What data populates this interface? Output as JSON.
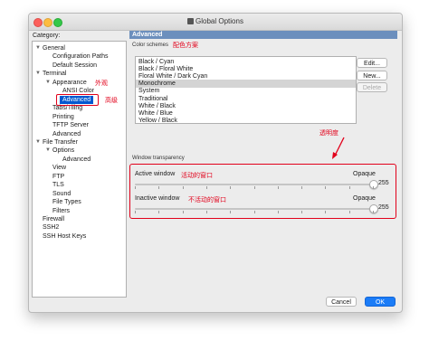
{
  "window": {
    "title": "Global Options"
  },
  "category": {
    "label": "Category:",
    "tree": [
      {
        "label": "General",
        "level": 0,
        "expanded": true
      },
      {
        "label": "Configuration Paths",
        "level": 1
      },
      {
        "label": "Default Session",
        "level": 1
      },
      {
        "label": "Terminal",
        "level": 0,
        "expanded": true
      },
      {
        "label": "Appearance",
        "level": 1,
        "expanded": true
      },
      {
        "label": "ANSI Color",
        "level": 2
      },
      {
        "label": "Advanced",
        "level": 2,
        "selected": true
      },
      {
        "label": "Tabs/Tiling",
        "level": 1
      },
      {
        "label": "Printing",
        "level": 1
      },
      {
        "label": "TFTP Server",
        "level": 1
      },
      {
        "label": "Advanced",
        "level": 1
      },
      {
        "label": "File Transfer",
        "level": 0,
        "expanded": true
      },
      {
        "label": "Options",
        "level": 1,
        "expanded": true
      },
      {
        "label": "Advanced",
        "level": 2
      },
      {
        "label": "View",
        "level": 1
      },
      {
        "label": "FTP",
        "level": 1
      },
      {
        "label": "TLS",
        "level": 1
      },
      {
        "label": "Sound",
        "level": 1
      },
      {
        "label": "File Types",
        "level": 1
      },
      {
        "label": "Filters",
        "level": 1
      },
      {
        "label": "Firewall",
        "level": 0
      },
      {
        "label": "SSH2",
        "level": 0
      },
      {
        "label": "SSH Host Keys",
        "level": 0
      }
    ]
  },
  "panel": {
    "title": "Advanced"
  },
  "color_schemes": {
    "title": "Color schemes",
    "items": [
      "Black / Cyan",
      "Black / Floral White",
      "Floral White / Dark Cyan",
      "Monochrome",
      "System",
      "Traditional",
      "White / Black",
      "White / Blue",
      "Yellow / Black"
    ],
    "selected_index": 3,
    "buttons": {
      "edit": "Edit...",
      "new": "New...",
      "delete": "Delete"
    }
  },
  "transparency": {
    "title": "Window transparency",
    "active": {
      "label": "Active window",
      "annotation": "活动的窗口",
      "end_label": "Opaque",
      "value": "255",
      "level": 1.0
    },
    "inactive": {
      "label": "Inactive window",
      "annotation": "不活动的窗口",
      "end_label": "Opaque",
      "value": "255",
      "level": 1.0
    }
  },
  "annotations": {
    "appearance": "外观",
    "advanced": "高级",
    "color_schemes": "配色方案",
    "transparency": "透明度"
  },
  "footer": {
    "cancel": "Cancel",
    "ok": "OK"
  },
  "colors": {
    "accent": "#1b7cf7",
    "selection": "#0058d0",
    "annotation_red": "#e2001a",
    "header_blue": "#6c8fbd"
  }
}
